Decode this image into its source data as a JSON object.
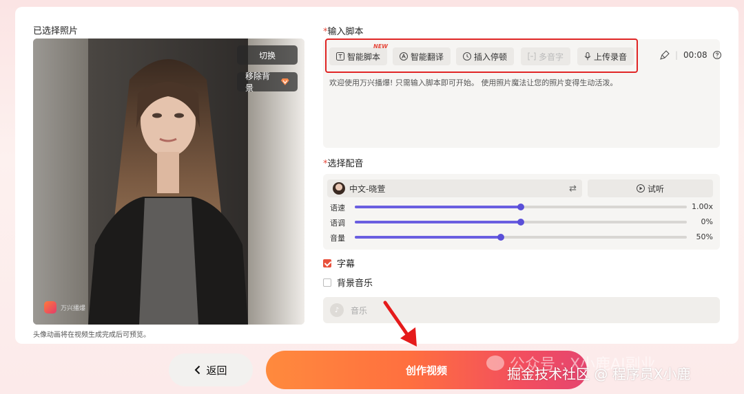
{
  "photo_section": {
    "label": "已选择照片",
    "switch_label": "切换",
    "remove_bg_label": "移除背景",
    "watermark_text": "万兴播爆",
    "hint": "头像动画将在视频生成完成后可预览。"
  },
  "script_section": {
    "label": "输入脚本",
    "tools": {
      "smart_script": "智能脚本",
      "new_badge": "NEW",
      "smart_translate": "智能翻译",
      "insert_pause": "插入停顿",
      "polyphonic": "多音字",
      "upload_audio": "上传录音"
    },
    "duration": "00:08",
    "placeholder_text": "欢迎使用万兴播爆! 只需输入脚本即可开始。 使用照片魔法让您的照片变得生动活泼。"
  },
  "voice_section": {
    "label": "选择配音",
    "voice_name": "中文-晓萱",
    "preview_label": "试听",
    "sliders": {
      "speed": {
        "label": "语速",
        "value": "1.00x",
        "fraction": 0.5
      },
      "pitch": {
        "label": "语调",
        "value": "0%",
        "fraction": 0.5
      },
      "volume": {
        "label": "音量",
        "value": "50%",
        "fraction": 0.44
      }
    }
  },
  "options": {
    "subtitle_label": "字幕",
    "subtitle_checked": true,
    "bgm_label": "背景音乐",
    "bgm_checked": false,
    "music_placeholder": "音乐"
  },
  "actions": {
    "back_label": "返回",
    "create_label": "创作视频"
  },
  "watermarks": {
    "overlay_text": "公众号 · X小鹿AI副业",
    "footer_text": "掘金技术社区 @ 程序员X小鹿"
  },
  "colors": {
    "accent_orange": "#ff7a3c",
    "highlight_red": "#e02424",
    "slider_purple": "#6a5ee0"
  }
}
